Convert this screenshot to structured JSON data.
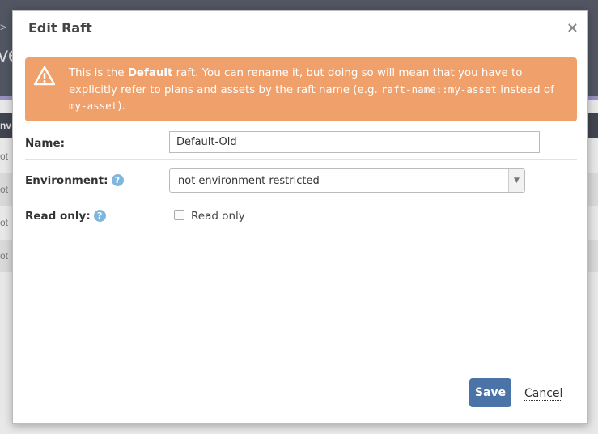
{
  "background": {
    "breadcrumb_fragment": ">",
    "heading_fragment": "ve",
    "column_fragment": "nv",
    "row_fragments": [
      "ot",
      "ot",
      "ot",
      "ot"
    ]
  },
  "modal": {
    "title": "Edit Raft",
    "close_symbol": "×",
    "alert": {
      "icon": "warning-triangle-icon",
      "text_before_bold": "This is the ",
      "bold_text": "Default",
      "text_after_bold": " raft. You can rename it, but doing so will mean that you have to explicitly refer to plans and assets by the raft name (e.g. ",
      "code_example_1": "raft-name::my-asset",
      "text_between_codes": " instead of ",
      "code_example_2": "my-asset",
      "text_end": ")."
    },
    "form": {
      "name": {
        "label": "Name:",
        "value": "Default-Old"
      },
      "environment": {
        "label": "Environment:",
        "help": "?",
        "selected": "not environment restricted",
        "arrow": "▼"
      },
      "read_only": {
        "label": "Read only:",
        "help": "?",
        "checkbox_label": "Read only",
        "checked": false
      }
    },
    "buttons": {
      "save": "Save",
      "cancel": "Cancel"
    }
  },
  "colors": {
    "alert_bg": "#f0a06a",
    "save_bg": "#4a74a8",
    "help_badge": "#7db6de",
    "header_bg": "#525663"
  }
}
